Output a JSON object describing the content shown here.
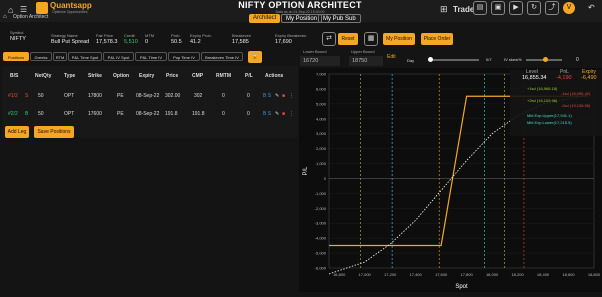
{
  "app": {
    "brand": "Quantsapp",
    "tagline": "Optimise Opportunities",
    "title": "NIFTY OPTION ARCHITECT",
    "subtitle": "Data as on 21-Sep-22 15:30:00"
  },
  "nav": {
    "home_label": "Option Architect",
    "tabs": [
      "Architect",
      "My Position",
      "My Pub Sub"
    ],
    "trade_label": "Trade",
    "avatar": "V"
  },
  "info": {
    "symbol_hdr": "Symbol",
    "symbol": "NIFTY",
    "strategy_hdr": "Strategy Name",
    "strategy": "Bull Put Spread",
    "fair_hdr": "Fair Price",
    "fair": "17,578.3",
    "credit_hdr": "Credit",
    "credit": "5,510",
    "mtm_hdr": "MTM",
    "mtm": "0",
    "pop_hdr": "Prob.",
    "pop": "50.5",
    "expop_hdr": "Expiry Prob.",
    "expop": "41.2",
    "be_hdr": "Breakeven",
    "be": "17,585",
    "ebe_hdr": "Expiry Breakeven",
    "ebe": "17,690",
    "reset": "Reset",
    "mypos": "My Position",
    "place": "Place Order"
  },
  "bounds": {
    "lower_hdr": "Lower Bound",
    "lower": "16720",
    "upper_hdr": "Upper Bound",
    "upper": "18750",
    "edit": "Edit",
    "day": "Day",
    "day_val": "0/7",
    "iv_hdr": "IV skew%",
    "iv_val": "0"
  },
  "tabs": [
    "Positions",
    "Greeks",
    "RTM",
    "P&L Time Spot",
    "P&L IV Spot",
    "P&L Time IV",
    "Pop Time IV",
    "Breakeven Time IV"
  ],
  "table": {
    "headers": [
      "B/S",
      "NetQty",
      "Type",
      "Strike",
      "Option",
      "Expiry",
      "Price",
      "CMP",
      "RMTM",
      "P/L",
      "Actions"
    ],
    "rows": [
      {
        "bs": "#1/2",
        "side": "S",
        "qty": "50",
        "type": "OPT",
        "strike": "17800",
        "opt": "PE",
        "exp": "08-Sep-22",
        "price": "302.00",
        "cmp": "302",
        "rmtm": "0",
        "pl": "0"
      },
      {
        "bs": "#2/2",
        "side": "B",
        "qty": "50",
        "type": "OPT",
        "strike": "17600",
        "opt": "PE",
        "exp": "08-Sep-22",
        "price": "191.8",
        "cmp": "191.8",
        "rmtm": "0",
        "pl": "0"
      }
    ]
  },
  "buttons": {
    "add_leg": "Add Leg",
    "save": "Save Positions"
  },
  "summary": {
    "level_hdr": "Level",
    "level": "16,855.34",
    "pnl_hdr": "PnL",
    "pnl": "-4,190",
    "expiry_hdr": "Expiry",
    "expiry": "-6,490"
  },
  "legend": [
    {
      "label": "+1sd (16,968.18)",
      "color": "#9acd32"
    },
    {
      "label": "-1sd (18,096.42)",
      "color": "#e74c3c"
    },
    {
      "label": "+2sd (16,109.96)",
      "color": "#9acd32"
    },
    {
      "label": "-2sd (19,136.56)",
      "color": "#e74c3c"
    },
    {
      "label": "Mkt Exp.Upper(17,941.1)",
      "color": "#40e0d0"
    },
    {
      "label": "Mkt Exp.Lower(17,215.5)",
      "color": "#40e0d0"
    }
  ],
  "chart_data": {
    "type": "line",
    "xlabel": "Spot",
    "ylabel": "P/L",
    "x_ticks": [
      "16,800",
      "17,000",
      "17,200",
      "17,400",
      "17,600",
      "17,800",
      "18,000",
      "18,200",
      "18,400",
      "18,600",
      "18,800"
    ],
    "y_ticks": [
      "7,000",
      "6,000",
      "5,000",
      "4,000",
      "3,000",
      "2,000",
      "1,000",
      "0",
      "-1,000",
      "-2,000",
      "-3,000",
      "-4,000",
      "-5,000",
      "-6,000"
    ],
    "series": [
      {
        "x": [
          16720,
          17600,
          17800,
          18750
        ],
        "values": [
          -4490,
          -4490,
          5510,
          5510
        ],
        "color": "#f5a623"
      },
      {
        "x": [
          16720,
          17000,
          17200,
          17400,
          17600,
          17800,
          18000,
          18200,
          18400,
          18750
        ],
        "values": [
          -6400,
          -5600,
          -4400,
          -2800,
          -800,
          1200,
          3000,
          4200,
          5000,
          5600
        ],
        "color": "#ffffff"
      }
    ],
    "ylim": [
      -6000,
      7000
    ],
    "xlim": [
      16720,
      18800
    ],
    "vlines": [
      {
        "x": 17215.5,
        "color": "#40e0d0"
      },
      {
        "x": 17941.1,
        "color": "#40e0d0"
      },
      {
        "x": 16968.18,
        "color": "#9acd32"
      },
      {
        "x": 18096.42,
        "color": "#9acd32"
      },
      {
        "x": 17585,
        "color": "#f5a623"
      },
      {
        "x": 18250,
        "color": "#e74c3c"
      }
    ]
  }
}
